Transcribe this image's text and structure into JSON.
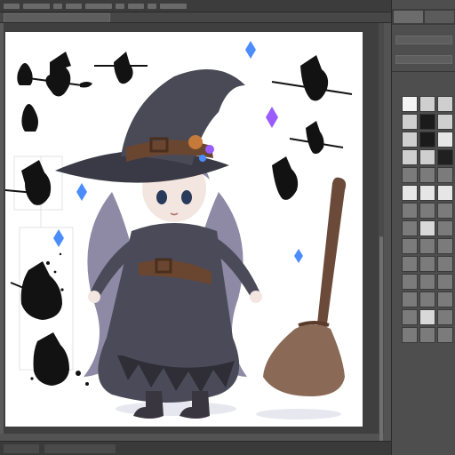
{
  "window": {
    "title": "",
    "document_tab": ""
  },
  "menu": {
    "items": [
      "",
      "",
      "",
      "",
      "",
      "",
      "",
      "",
      ""
    ]
  },
  "right_panel": {
    "tabs": [
      "",
      ""
    ],
    "row_1": "",
    "row_2": ""
  },
  "swatches": [
    "#f3f3f3",
    "#cfcfcf",
    "#cfcfcf",
    "#cfcfcf",
    "#1b1b1b",
    "#cfcfcf",
    "#cfcfcf",
    "#1b1b1b",
    "#e6e6e6",
    "#cfcfcf",
    "#cfcfcf",
    "#202020",
    "#7b7b7b",
    "#7b7b7b",
    "#7b7b7b",
    "#e6e6e6",
    "#e6e6e6",
    "#e6e6e6",
    "#7b7b7b",
    "#7b7b7b",
    "#7b7b7b",
    "#7b7b7b",
    "#d8d8d8",
    "#7b7b7b",
    "#7b7b7b",
    "#7b7b7b",
    "#7b7b7b",
    "#7b7b7b",
    "#7b7b7b",
    "#7b7b7b",
    "#7b7b7b",
    "#7b7b7b",
    "#7b7b7b",
    "#7b7b7b",
    "#7b7b7b",
    "#7b7b7b",
    "#7b7b7b",
    "#d8d8d8",
    "#7b7b7b",
    "#7b7b7b",
    "#7b7b7b",
    "#7b7b7b"
  ],
  "status": {
    "zoom": "",
    "info": ""
  },
  "artwork": {
    "subject": "",
    "colors": {
      "hat": "#4a4a56",
      "hat_brim": "#3a3a46",
      "hair": "#8e8aa6",
      "dress": "#4b4a58",
      "dress_dark": "#2f2e37",
      "skin": "#f3e6e0",
      "belt": "#6a4630",
      "broom_handle": "#6b4a3a",
      "broom_bristles": "#8a6a56",
      "silhouette": "#111111",
      "gem_blue": "#4b8cff",
      "gem_purple": "#9a5cff"
    }
  }
}
